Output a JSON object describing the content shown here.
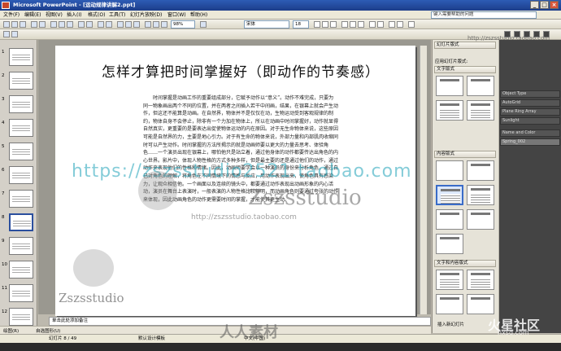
{
  "window": {
    "title": "Microsoft PowerPoint - [运动规律讲解2.ppt]",
    "min": "_",
    "max": "□",
    "close": "×"
  },
  "menu": [
    "文件(F)",
    "编辑(E)",
    "视图(V)",
    "插入(I)",
    "格式(O)",
    "工具(T)",
    "幻灯片放映(D)",
    "窗口(W)",
    "帮助(H)"
  ],
  "help_placeholder": "键入需要帮助的问题",
  "toolbar": {
    "zoom": "98%",
    "font": "宋体",
    "size": "18"
  },
  "thumbnails": [
    "1",
    "2",
    "3",
    "4",
    "5",
    "6",
    "7",
    "8",
    "9",
    "10",
    "11",
    "12"
  ],
  "slide": {
    "title": "怎样才算把时间掌握好（即动作的节奏感）",
    "body": "时间掌握是动画工作的重要组成部分，它赋予动作以“意义”。动作不难完成，只要为同一物象画出两个不同的位置，并在两者之间插入若干中间画，结果，在银幕上就会产生动作，但这还不能算是动画。在自然界，物体并不是仅仅在动，生物运动受到客观规律的制约，物体自身不会停止，除非有一个力加在物体上，所以在动画中时间掌握好，动作就显得自然真实，更重要的是要表达出促使物体运动的内在原因。对于无生命物体来说，这些原因可能是自然界的力，主要是地心引力。对于有生命的物体来说，外部力量和内部肌肉收缩同时可以产生动作。时间掌握的方法所揭示的就是动画师要以更大的力量去思考、体验角色……一个演员出现在银幕上，哪怕他只是站立着，通过他身体的动作都要传达出角色的内心世界。影片中，体现人物性格的方式多种多样，但是最主要的还是通过他们的动作，通过动作来表现他们的性格和情绪。因此，动画师要学会以一种演员的身份来分析角色，通过自己对角色的理解，将角色在不同情境下的情感与反应，用动作表现出来，使角色具有感染力，让观众相信他。一个画面以及连续的镜头中，都要通过动作表现出动画形象的内心活动，演员在舞台上表演时，一般表演的人物性格比较鲜明，而动画角色则要通过夸张的动作来体现，因此动画角色的动作更需要时间的掌握，才能使其更生动。"
  },
  "notes_placeholder": "单击此处添加备注",
  "taskpane": {
    "title": "幻灯片版式",
    "apply_label": "应用幻灯片版式:",
    "section_text": "文字版式",
    "section_content": "内容版式",
    "section_text_content": "文字和内容版式",
    "footer": "插入新幻灯片"
  },
  "max_panel": {
    "rows": [
      "Object Type",
      "AutoGrid",
      "Plane  Ring Array",
      "Sunlight",
      "Name and Color",
      "Spring_002"
    ]
  },
  "drawbar": {
    "draw": "绘图(R)",
    "autoshapes": "自选图形(U)"
  },
  "status": {
    "slide_count": "幻灯片 8 / 49",
    "design": "默认设计模板",
    "lang": "中文(中国)"
  },
  "watermarks": {
    "url": "https://zszsstudio2521.taobao.com",
    "brand": "Zszsstudio",
    "brand_url": "http://zszsstudio.taobao.com",
    "top_url": "http://zszsstudio.taobao.com",
    "cn_site": "人人素材",
    "cn_forum": "火星社区",
    "cn_forum_url": "hxsd.com"
  },
  "colors": {
    "title_blue": "#2d5cb5",
    "select_blue": "#3a6cc8",
    "watermark_teal": "#1fa3b8"
  }
}
